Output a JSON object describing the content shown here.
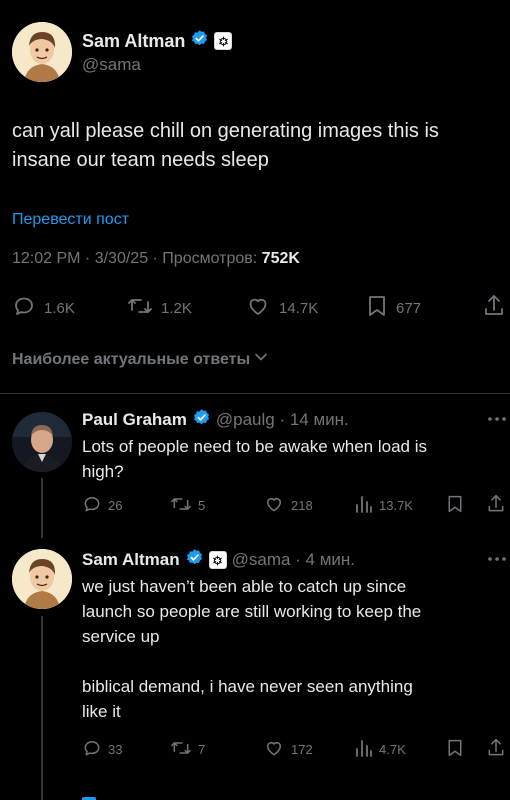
{
  "tweet": {
    "author_name": "Sam Altman",
    "author_handle": "@sama",
    "text": "can yall please chill on generating images this is insane our team needs sleep",
    "translate_label": "Перевести пост",
    "meta_time": "12:02 PM · 3/30/25 · Просмотров: ",
    "views": "752K",
    "stats": {
      "replies": "1.6K",
      "retweets": "1.2K",
      "likes": "14.7K",
      "bookmarks": "677"
    }
  },
  "replies_sort_label": "Наиболее актуальные ответы",
  "replies": [
    {
      "author_name": "Paul Graham",
      "handle_time": "@paulg · 14 мин.",
      "text_line1": "Lots of people need to be awake when load is",
      "text_line2": "high?",
      "stats": {
        "replies": "26",
        "retweets": "5",
        "likes": "218",
        "views": "13.7K"
      }
    },
    {
      "author_name": "Sam Altman",
      "handle_time": "@sama · 4 мин.",
      "text_line1": "we just haven’t been able to catch up since",
      "text_line2": "launch so people are still working to keep the",
      "text_line3": "service up",
      "text_line4": "biblical demand, i have never seen anything",
      "text_line5": "like it",
      "stats": {
        "replies": "33",
        "retweets": "7",
        "likes": "172",
        "views": "4.7K"
      }
    }
  ],
  "colors": {
    "background": "#000000",
    "text": "#e7e9ea",
    "muted": "#71767b",
    "accent": "#1d9bf0",
    "divider": "#2f3336"
  },
  "icons": [
    "verified-badge-icon",
    "openai-affiliate-icon",
    "reply-icon",
    "retweet-icon",
    "like-icon",
    "bookmark-icon",
    "share-icon",
    "views-icon",
    "more-icon",
    "chevron-down-icon"
  ]
}
